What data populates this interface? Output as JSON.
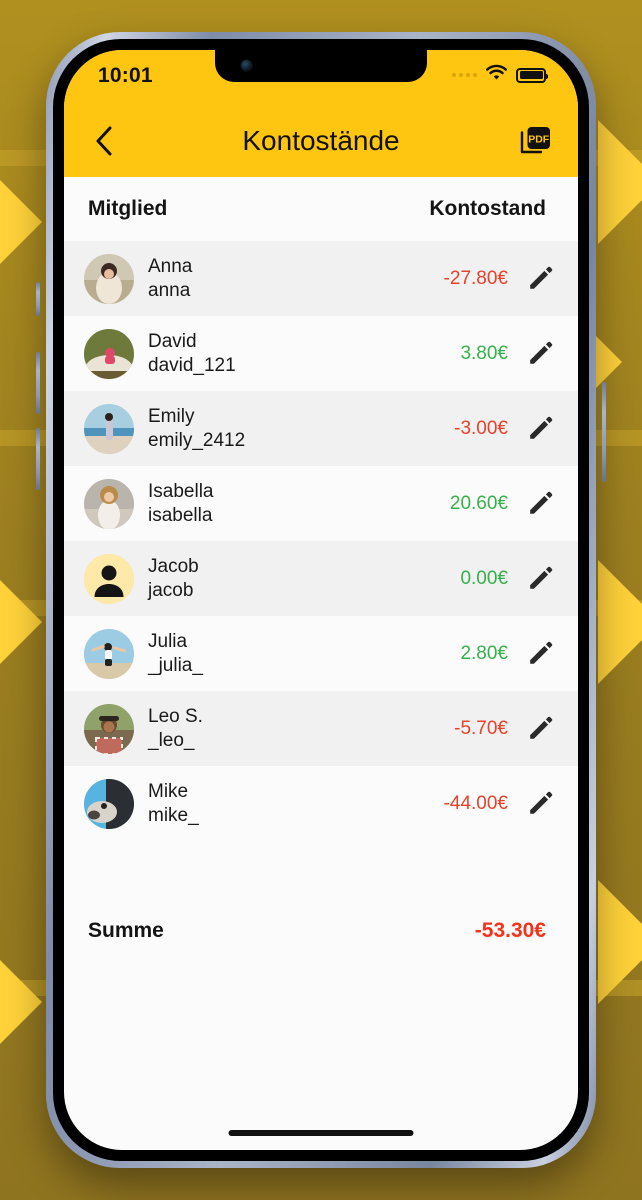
{
  "status_bar": {
    "time": "10:01",
    "signal_icon": "signal-dots-icon",
    "wifi_icon": "wifi-icon",
    "battery_icon": "battery-full-icon"
  },
  "nav": {
    "back_icon": "chevron-left-icon",
    "title": "Kontostände",
    "pdf_icon": "pdf-export-icon"
  },
  "table": {
    "columns": {
      "member": "Mitglied",
      "balance": "Kontostand"
    },
    "rows": [
      {
        "name": "Anna",
        "username": "anna",
        "balance": "-27.80€",
        "sign": "neg",
        "avatar": "photo",
        "edit_icon": "pencil-icon"
      },
      {
        "name": "David",
        "username": "david_121",
        "balance": "3.80€",
        "sign": "pos",
        "avatar": "photo",
        "edit_icon": "pencil-icon"
      },
      {
        "name": "Emily",
        "username": "emily_2412",
        "balance": "-3.00€",
        "sign": "neg",
        "avatar": "photo",
        "edit_icon": "pencil-icon"
      },
      {
        "name": "Isabella",
        "username": "isabella",
        "balance": "20.60€",
        "sign": "pos",
        "avatar": "photo",
        "edit_icon": "pencil-icon"
      },
      {
        "name": "Jacob",
        "username": "jacob",
        "balance": "0.00€",
        "sign": "pos",
        "avatar": "placeholder",
        "edit_icon": "pencil-icon"
      },
      {
        "name": "Julia",
        "username": "_julia_",
        "balance": "2.80€",
        "sign": "pos",
        "avatar": "photo",
        "edit_icon": "pencil-icon"
      },
      {
        "name": "Leo S.",
        "username": "_leo_",
        "balance": "-5.70€",
        "sign": "neg",
        "avatar": "photo",
        "edit_icon": "pencil-icon"
      },
      {
        "name": "Mike",
        "username": "mike_",
        "balance": "-44.00€",
        "sign": "neg",
        "avatar": "photo",
        "edit_icon": "pencil-icon"
      }
    ]
  },
  "summary": {
    "label": "Summe",
    "value": "-53.30€"
  },
  "colors": {
    "brand_yellow": "#ffc611",
    "negative": "#e8412c",
    "positive": "#36b14a",
    "sum_negative": "#f5321a",
    "row_alt": "#f1f1f1",
    "row_plain": "#fbfbfb",
    "backdrop": "#9c7f20",
    "chevron": "#ffd23a"
  }
}
